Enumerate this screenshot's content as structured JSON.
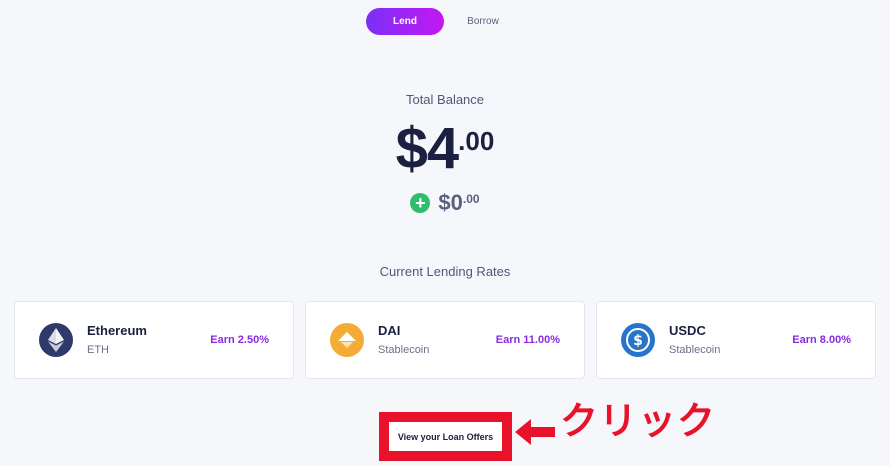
{
  "toggle": {
    "lend_label": "Lend",
    "borrow_label": "Borrow"
  },
  "balance": {
    "label": "Total Balance",
    "integer": "$4",
    "decimal": ".00",
    "pending_integer": "$0",
    "pending_decimal": ".00",
    "pending_icon": "plus-circle-icon"
  },
  "rates": {
    "label": "Current Lending Rates",
    "cards": [
      {
        "name": "Ethereum",
        "subtitle": "ETH",
        "earn": "Earn 2.50%",
        "icon": "ethereum-icon"
      },
      {
        "name": "DAI",
        "subtitle": "Stablecoin",
        "earn": "Earn 11.00%",
        "icon": "dai-icon"
      },
      {
        "name": "USDC",
        "subtitle": "Stablecoin",
        "earn": "Earn 8.00%",
        "icon": "usdc-icon"
      }
    ]
  },
  "offers": {
    "button_label": "View your Loan Offers"
  },
  "annotation": {
    "label": "クリック",
    "color": "#e8132a"
  },
  "colors": {
    "accent_start": "#7b2ff7",
    "accent_end": "#c318f2",
    "earn": "#8a2be2",
    "plus": "#2ebd6e"
  }
}
